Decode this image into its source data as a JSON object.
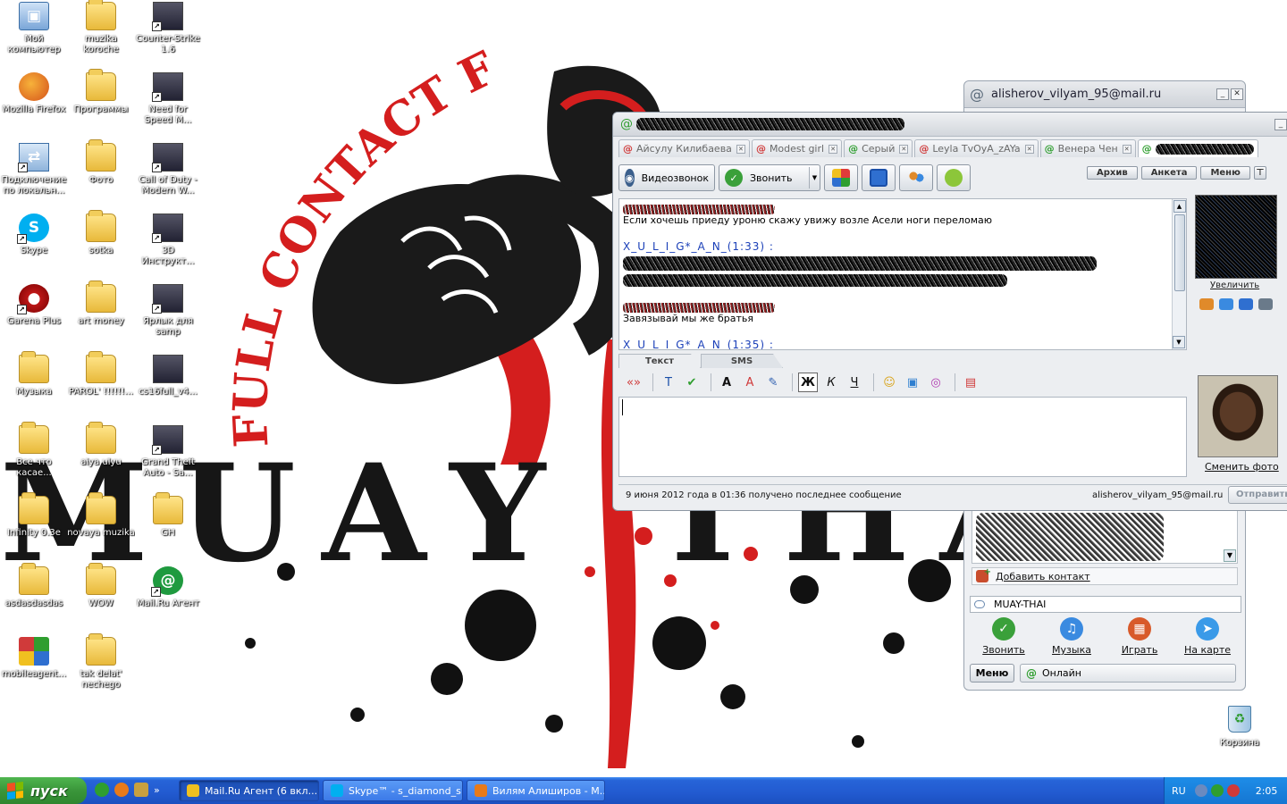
{
  "wallpaper": {
    "arc_text": "FULL CONTACT F",
    "big_text": "MUAY THAI"
  },
  "desktop_icons": [
    {
      "label": "Мой компьютер",
      "kind": "computer",
      "shortcut": false
    },
    {
      "label": "muzika koroche",
      "kind": "folder",
      "shortcut": false
    },
    {
      "label": "Counter-Strike 1.6",
      "kind": "app",
      "shortcut": true
    },
    {
      "label": "Mozilla Firefox",
      "kind": "firefox",
      "shortcut": false
    },
    {
      "label": "Программы",
      "kind": "folder",
      "shortcut": false
    },
    {
      "label": "Need for Speed M...",
      "kind": "app",
      "shortcut": true
    },
    {
      "label": "Подключение по локальн...",
      "kind": "network",
      "shortcut": true
    },
    {
      "label": "Фото",
      "kind": "folder",
      "shortcut": false
    },
    {
      "label": "Call of Duty - Modern W...",
      "kind": "app",
      "shortcut": true
    },
    {
      "label": "Skype",
      "kind": "skype",
      "shortcut": true
    },
    {
      "label": "sotka",
      "kind": "folder",
      "shortcut": false
    },
    {
      "label": "3D Инструкт...",
      "kind": "app",
      "shortcut": true
    },
    {
      "label": "Garena Plus",
      "kind": "garena",
      "shortcut": true
    },
    {
      "label": "art money",
      "kind": "folder",
      "shortcut": false
    },
    {
      "label": "Ярлык для samp",
      "kind": "app",
      "shortcut": true
    },
    {
      "label": "Музыка",
      "kind": "folder",
      "shortcut": false
    },
    {
      "label": "PAROL' !!!!!!...",
      "kind": "folder",
      "shortcut": false
    },
    {
      "label": "cs16full_v4...",
      "kind": "app",
      "shortcut": false
    },
    {
      "label": "Все что касае...",
      "kind": "folder",
      "shortcut": false
    },
    {
      "label": "aiya ulyu",
      "kind": "folder",
      "shortcut": false
    },
    {
      "label": "Grand Theft Auto - Sa...",
      "kind": "app",
      "shortcut": true
    },
    {
      "label": "Infinity 0.3e",
      "kind": "folder",
      "shortcut": false
    },
    {
      "label": "novaya muzika",
      "kind": "folder",
      "shortcut": false
    },
    {
      "label": "GH",
      "kind": "folder",
      "shortcut": false
    },
    {
      "label": "asdasdasdas",
      "kind": "folder",
      "shortcut": false
    },
    {
      "label": "WOW",
      "kind": "folder",
      "shortcut": false
    },
    {
      "label": "Mail.Ru Агент",
      "kind": "mailru",
      "shortcut": true
    },
    {
      "label": "mobileagent...",
      "kind": "mobile",
      "shortcut": false
    },
    {
      "label": "tak delat' nechego",
      "kind": "folder",
      "shortcut": false
    }
  ],
  "contact_window": {
    "title": "alisherov_vilyam_95@mail.ru",
    "add_contact": "Добавить контакт",
    "status_text": "MUAY-THAI",
    "actions": [
      {
        "label": "Звонить",
        "icon": "call-icon",
        "color": "#3aa03a",
        "glyph": "✓"
      },
      {
        "label": "Музыка",
        "icon": "music-icon",
        "color": "#3a8ae0",
        "glyph": "♫"
      },
      {
        "label": "Играть",
        "icon": "games-icon",
        "color": "#d85a2a",
        "glyph": "▦"
      },
      {
        "label": "На карте",
        "icon": "map-icon",
        "color": "#3a9ae8",
        "glyph": "➤"
      }
    ],
    "menu_label": "Меню",
    "online_status": "Онлайн"
  },
  "chat_window": {
    "tabs": [
      {
        "label": "Айсулу Килибаева",
        "at_color": "#d03a3a"
      },
      {
        "label": "Modest girl",
        "at_color": "#d03a3a"
      },
      {
        "label": "Серый",
        "at_color": "#2f9e2f"
      },
      {
        "label": "Leyla TvOyA_zAYa",
        "at_color": "#d03a3a"
      },
      {
        "label": "Венера Чен",
        "at_color": "#2f9e2f"
      }
    ],
    "toolbar": {
      "video_call": "Видеозвонок",
      "call": "Звонить"
    },
    "right_menu": [
      "Архив",
      "Анкета",
      "Меню"
    ],
    "history": [
      {
        "sender": "",
        "sender_redacted": true,
        "text": "Если хочешь приеду уроню скажу увижу возле Асели ноги переломаю"
      },
      {
        "sender": "X_U_L_I_G*_A_N_(1:33) :",
        "sender_redacted": false,
        "text": "",
        "text_redacted": true
      },
      {
        "sender": "",
        "sender_redacted": true,
        "text": "Завязывай мы же братья"
      },
      {
        "sender": "X_U_L_I_G*_A_N_(1:35) :",
        "sender_redacted": false,
        "text": ""
      }
    ],
    "zoom_link": "Увеличить",
    "input_tabs": [
      "Текст",
      "SMS"
    ],
    "format_tools": [
      {
        "name": "quote-icon",
        "glyph": "«»",
        "color": "#d03a3a"
      },
      {
        "name": "text-style-icon",
        "glyph": "T",
        "color": "#1a4fa8"
      },
      {
        "name": "spellcheck-icon",
        "glyph": "✔",
        "color": "#2f9e2f"
      },
      {
        "name": "font-icon",
        "glyph": "A",
        "color": "#111"
      },
      {
        "name": "font-color-icon",
        "glyph": "A",
        "color": "#d03a3a"
      },
      {
        "name": "highlight-icon",
        "glyph": "✎",
        "color": "#2f5fb0"
      },
      {
        "name": "bold-button",
        "glyph": "Ж",
        "color": "#111"
      },
      {
        "name": "italic-button",
        "glyph": "К",
        "color": "#111"
      },
      {
        "name": "underline-button",
        "glyph": "Ч",
        "color": "#111"
      },
      {
        "name": "smiley-icon",
        "glyph": "☺",
        "color": "#d9a41a"
      },
      {
        "name": "flash-icon",
        "glyph": "▣",
        "color": "#2f7fd0"
      },
      {
        "name": "alarm-icon",
        "glyph": "◎",
        "color": "#b03ab0"
      },
      {
        "name": "screenshot-icon",
        "glyph": "▤",
        "color": "#d03a3a"
      }
    ],
    "change_photo": "Сменить фото",
    "status_message": "9 июня 2012 года в 01:36 получено последнее сообщение",
    "status_email": "alisherov_vilyam_95@mail.ru",
    "send_button": "Отправить"
  },
  "recycle_bin": {
    "label": "Корзина"
  },
  "taskbar": {
    "start_label": "пуск",
    "tasks": [
      {
        "label": "Mail.Ru Агент (6 вкл...",
        "active": true,
        "icon_color": "#f0c020"
      },
      {
        "label": "Skype™ - s_diamond_s",
        "active": false,
        "icon_color": "#00aff0"
      },
      {
        "label": "Вилям Алиширов - М...",
        "active": false,
        "icon_color": "#e87a1a"
      }
    ],
    "language": "RU",
    "clock": "2:05"
  }
}
